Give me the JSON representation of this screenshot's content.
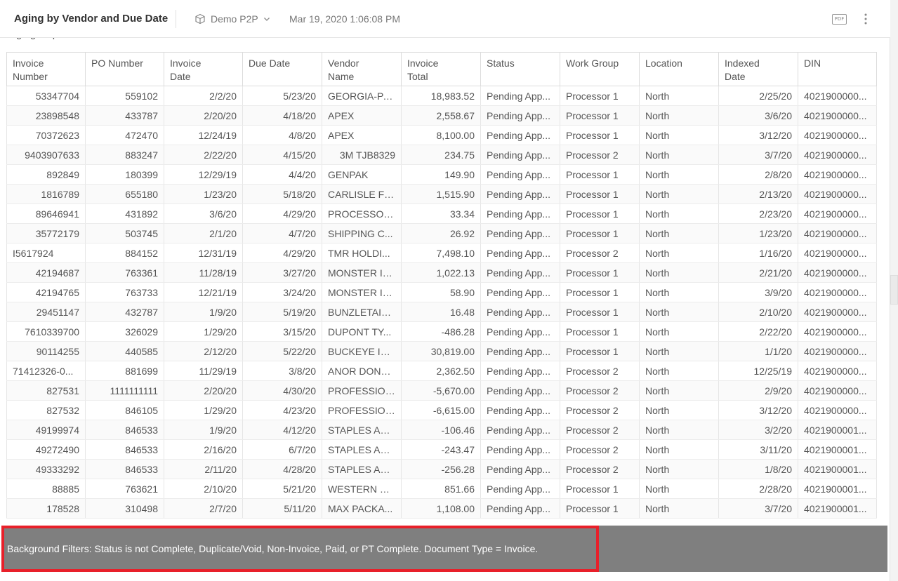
{
  "header": {
    "title": "Aging by Vendor and Due Date",
    "model_name": "Demo P2P",
    "timestamp": "Mar 19, 2020 1:06:08 PM",
    "pdf_label": "PDF"
  },
  "report": {
    "subtitle": "Aging Report Detail"
  },
  "table": {
    "columns": [
      {
        "line1": "Invoice",
        "line2": "Number"
      },
      {
        "line1": "PO Number",
        "line2": ""
      },
      {
        "line1": "Invoice",
        "line2": "Date"
      },
      {
        "line1": "Due Date",
        "line2": ""
      },
      {
        "line1": "Vendor",
        "line2": "Name"
      },
      {
        "line1": "Invoice",
        "line2": "Total"
      },
      {
        "line1": "Status",
        "line2": ""
      },
      {
        "line1": "Work Group",
        "line2": ""
      },
      {
        "line1": "Location",
        "line2": ""
      },
      {
        "line1": "Indexed",
        "line2": "Date"
      },
      {
        "line1": "DIN",
        "line2": ""
      }
    ],
    "rows": [
      [
        "53347704",
        "559102",
        "2/2/20",
        "5/23/20",
        "GEORGIA-PA...",
        "18,983.52",
        "Pending App...",
        "Processor 1",
        "North",
        "2/25/20",
        "4021900000..."
      ],
      [
        "23898548",
        "433787",
        "2/20/20",
        "4/18/20",
        "APEX",
        "2,558.67",
        "Pending App...",
        "Processor 1",
        "North",
        "3/6/20",
        "4021900000..."
      ],
      [
        "70372623",
        "472470",
        "12/24/19",
        "4/8/20",
        "APEX",
        "8,100.00",
        "Pending App...",
        "Processor 1",
        "North",
        "3/12/20",
        "4021900000..."
      ],
      [
        "9403907633",
        "883247",
        "2/22/20",
        "4/15/20",
        "3M TJB8329",
        "234.75",
        "Pending App...",
        "Processor 2",
        "North",
        "3/7/20",
        "4021900000..."
      ],
      [
        "892849",
        "180399",
        "12/29/19",
        "4/4/20",
        "GENPAK",
        "149.90",
        "Pending App...",
        "Processor 1",
        "North",
        "2/8/20",
        "4021900000..."
      ],
      [
        "1816789",
        "655180",
        "1/23/20",
        "5/18/20",
        "CARLISLE FO...",
        "1,515.90",
        "Pending App...",
        "Processor 1",
        "North",
        "2/13/20",
        "4021900000..."
      ],
      [
        "89646941",
        "431892",
        "3/6/20",
        "4/29/20",
        "PROCESSOR ...",
        "33.34",
        "Pending App...",
        "Processor 1",
        "North",
        "2/23/20",
        "4021900000..."
      ],
      [
        "35772179",
        "503745",
        "2/1/20",
        "4/7/20",
        "SHIPPING C...",
        "26.92",
        "Pending App...",
        "Processor 1",
        "North",
        "1/23/20",
        "4021900000..."
      ],
      [
        "I5617924",
        "884152",
        "12/31/19",
        "4/29/20",
        "TMR HOLDI...",
        "7,498.10",
        "Pending App...",
        "Processor 2",
        "North",
        "1/16/20",
        "4021900000..."
      ],
      [
        "42194687",
        "763361",
        "11/28/19",
        "3/27/20",
        "MONSTER INC",
        "1,022.13",
        "Pending App...",
        "Processor 1",
        "North",
        "2/21/20",
        "4021900000..."
      ],
      [
        "42194765",
        "763733",
        "12/21/19",
        "3/24/20",
        "MONSTER INC",
        "58.90",
        "Pending App...",
        "Processor 1",
        "North",
        "3/9/20",
        "4021900000..."
      ],
      [
        "29451147",
        "432787",
        "1/9/20",
        "5/19/20",
        "BUNZLETAIL ...",
        "16.48",
        "Pending App...",
        "Processor 1",
        "North",
        "2/10/20",
        "4021900000..."
      ],
      [
        "7610339700",
        "326029",
        "1/29/20",
        "3/15/20",
        "DUPONT TY...",
        "-486.28",
        "Pending App...",
        "Processor 1",
        "North",
        "2/22/20",
        "4021900000..."
      ],
      [
        "90114255",
        "440585",
        "2/12/20",
        "5/22/20",
        "BUCKEYE IN...",
        "30,819.00",
        "Pending App...",
        "Processor 1",
        "North",
        "1/1/20",
        "4021900000..."
      ],
      [
        "71412326-0...",
        "881699",
        "11/29/19",
        "3/8/20",
        "ANOR DONN...",
        "2,362.50",
        "Pending App...",
        "Processor 2",
        "North",
        "12/25/19",
        "4021900000..."
      ],
      [
        "827531",
        "1111111111",
        "2/20/20",
        "4/30/20",
        "PROFESSION...",
        "-5,670.00",
        "Pending App...",
        "Processor 2",
        "North",
        "2/9/20",
        "4021900000..."
      ],
      [
        "827532",
        "846105",
        "1/29/20",
        "4/23/20",
        "PROFESSION...",
        "-6,615.00",
        "Pending App...",
        "Processor 2",
        "North",
        "3/12/20",
        "4021900000..."
      ],
      [
        "49199974",
        "846533",
        "1/9/20",
        "4/12/20",
        "STAPLES AD...",
        "-106.46",
        "Pending App...",
        "Processor 2",
        "North",
        "3/2/20",
        "4021900001..."
      ],
      [
        "49272490",
        "846533",
        "2/16/20",
        "6/7/20",
        "STAPLES AD...",
        "-243.47",
        "Pending App...",
        "Processor 2",
        "North",
        "3/11/20",
        "4021900001..."
      ],
      [
        "49333292",
        "846533",
        "2/11/20",
        "4/28/20",
        "STAPLES AD...",
        "-256.28",
        "Pending App...",
        "Processor 2",
        "North",
        "1/8/20",
        "4021900001..."
      ],
      [
        "88885",
        "763621",
        "2/10/20",
        "5/21/20",
        "WESTERN PL...",
        "851.66",
        "Pending App...",
        "Processor 1",
        "North",
        "2/28/20",
        "4021900001..."
      ],
      [
        "178528",
        "310498",
        "2/7/20",
        "5/11/20",
        "MAX PACKA...",
        "1,108.00",
        "Pending App...",
        "Processor 1",
        "North",
        "3/7/20",
        "4021900001..."
      ]
    ],
    "alignments": [
      "r",
      "r",
      "r",
      "r",
      "l",
      "r",
      "l",
      "l",
      "l",
      "r",
      "l"
    ],
    "row_align_overrides": {
      "0:8": "l",
      "0:14": "l",
      "4:3": "r"
    }
  },
  "footer": {
    "text": "Background Filters: Status is not Complete, Duplicate/Void, Non-Invoice, Paid, or PT Complete. Document Type = Invoice.",
    "highlight_color": "#e8202a"
  },
  "colors": {
    "footer_bg": "#7f7f7f"
  }
}
